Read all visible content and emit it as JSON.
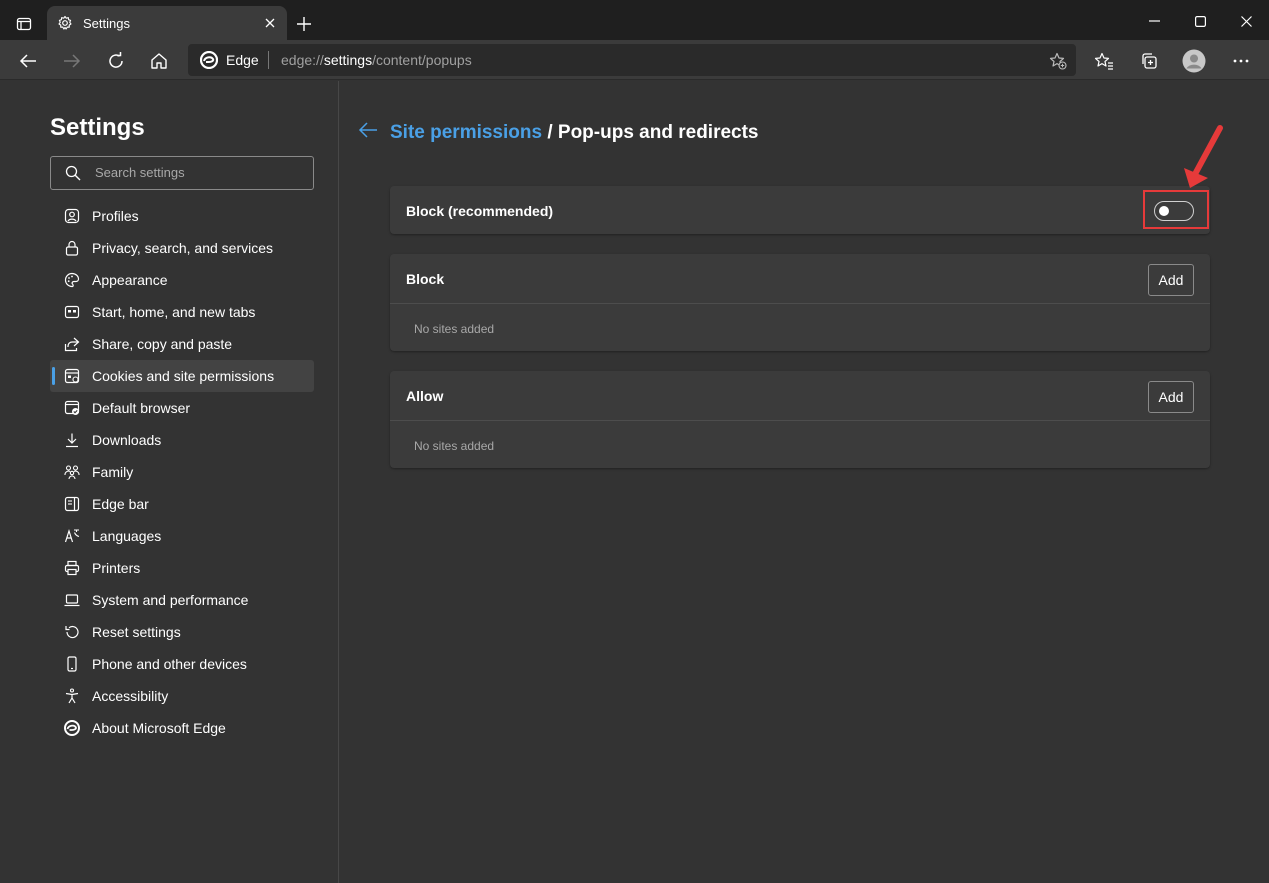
{
  "tab": {
    "title": "Settings"
  },
  "address": {
    "edge_label": "Edge",
    "url_prefix": "edge://",
    "url_bold": "settings",
    "url_suffix": "/content/popups"
  },
  "sidebar": {
    "title": "Settings",
    "search_placeholder": "Search settings",
    "items": [
      {
        "label": "Profiles",
        "icon": "profile-icon"
      },
      {
        "label": "Privacy, search, and services",
        "icon": "lock-icon"
      },
      {
        "label": "Appearance",
        "icon": "palette-icon"
      },
      {
        "label": "Start, home, and new tabs",
        "icon": "start-page-icon"
      },
      {
        "label": "Share, copy and paste",
        "icon": "share-icon"
      },
      {
        "label": "Cookies and site permissions",
        "icon": "cookies-icon",
        "active": true
      },
      {
        "label": "Default browser",
        "icon": "default-browser-icon"
      },
      {
        "label": "Downloads",
        "icon": "download-icon"
      },
      {
        "label": "Family",
        "icon": "family-icon"
      },
      {
        "label": "Edge bar",
        "icon": "edge-bar-icon"
      },
      {
        "label": "Languages",
        "icon": "languages-icon"
      },
      {
        "label": "Printers",
        "icon": "printer-icon"
      },
      {
        "label": "System and performance",
        "icon": "laptop-icon"
      },
      {
        "label": "Reset settings",
        "icon": "reset-icon"
      },
      {
        "label": "Phone and other devices",
        "icon": "phone-icon"
      },
      {
        "label": "Accessibility",
        "icon": "accessibility-icon"
      },
      {
        "label": "About Microsoft Edge",
        "icon": "edge-logo-icon"
      }
    ]
  },
  "main": {
    "breadcrumb_link": "Site permissions",
    "breadcrumb_sep": " / ",
    "breadcrumb_current": "Pop-ups and redirects",
    "block_recommended": {
      "label": "Block (recommended)",
      "enabled": false
    },
    "block": {
      "label": "Block",
      "add_label": "Add",
      "empty": "No sites added"
    },
    "allow": {
      "label": "Allow",
      "add_label": "Add",
      "empty": "No sites added"
    }
  },
  "colors": {
    "accent": "#4aa0e6",
    "annotation": "#e63a3a",
    "background": "#333333",
    "card": "#3b3b3b"
  }
}
